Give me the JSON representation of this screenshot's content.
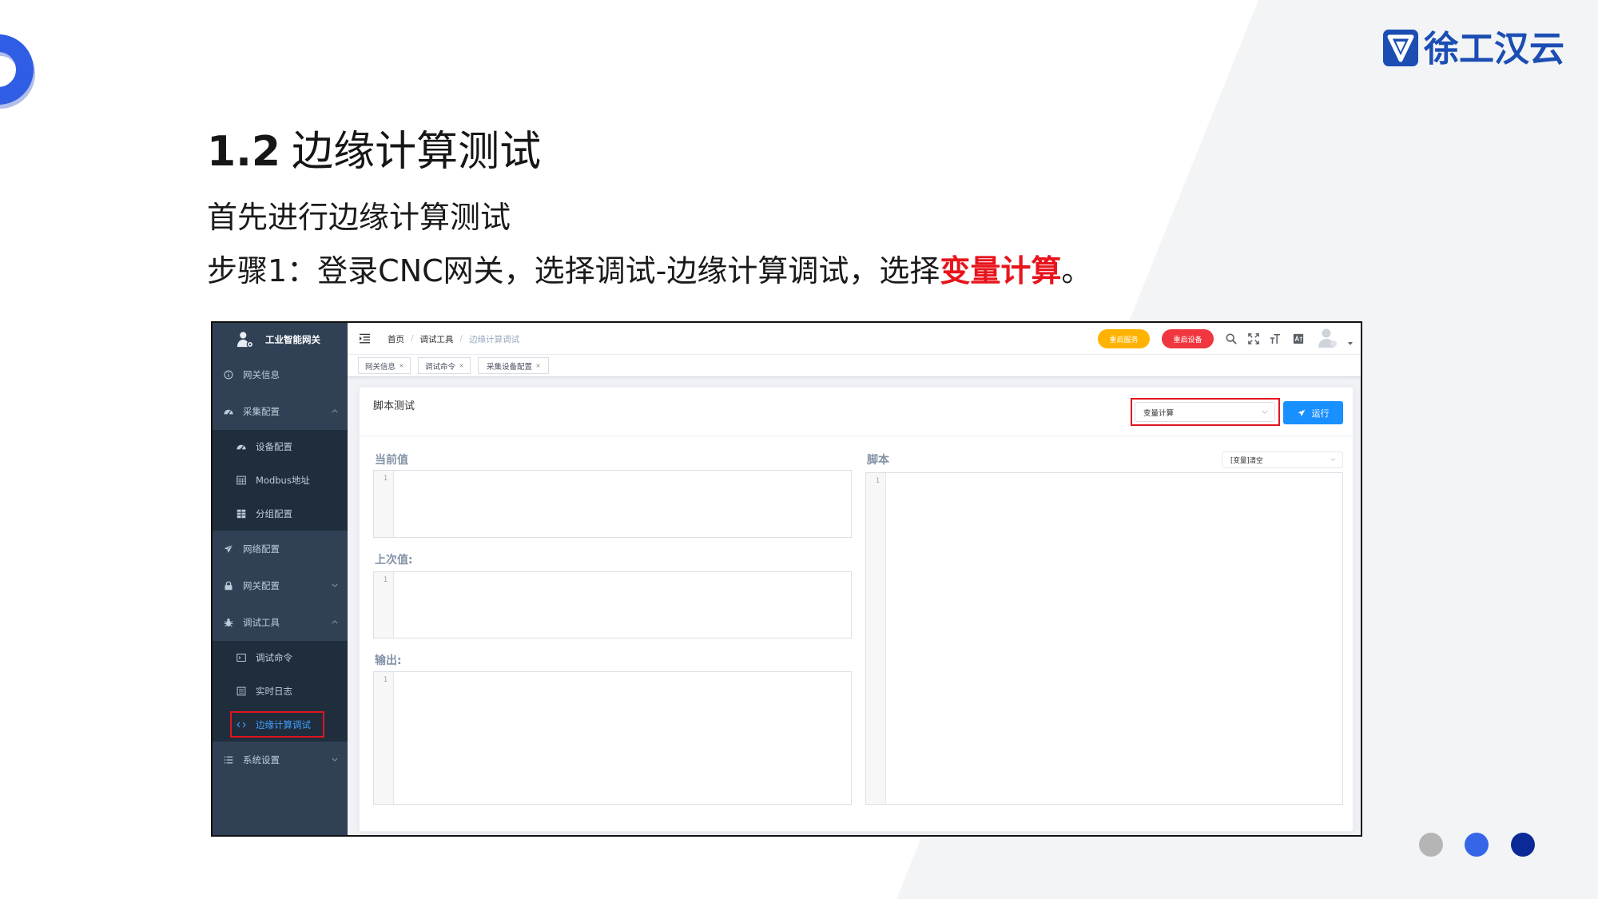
{
  "theme": {
    "brand_blue": "#1b4db3",
    "highlight_red": "#e8141c",
    "sidebar_bg": "#304156",
    "submenu_bg": "#1f2d3d",
    "sidebar_text": "#bfcbd9",
    "active_blue": "#409eff",
    "run_button": "#1890ff",
    "restart_service": "#ffb300",
    "restart_device": "#f0363f",
    "annotation_red": "#e0141e",
    "dot_gray": "#b5b5b5",
    "dot_blue": "#3566e8",
    "dot_navy": "#0b2a98"
  },
  "slide": {
    "logo_text": "徐工汉云",
    "logo_icon": "shield-logo-icon",
    "title_number": "1.2",
    "title_text": "边缘计算测试",
    "intro": "首先进行边缘计算测试",
    "step_prefix": "步骤1：登录CNC网关，选择调试-边缘计算调试，选择",
    "step_highlight": "变量计算",
    "step_suffix": "。"
  },
  "app": {
    "sidebar": {
      "title": "工业智能网关",
      "items": [
        {
          "label": "网关信息",
          "icon": "info-icon"
        },
        {
          "label": "采集配置",
          "icon": "dashboard-icon",
          "expanded": true,
          "children": [
            {
              "label": "设备配置",
              "icon": "dashboard-icon"
            },
            {
              "label": "Modbus地址",
              "icon": "table-icon"
            },
            {
              "label": "分组配置",
              "icon": "grid-icon"
            }
          ]
        },
        {
          "label": "网络配置",
          "icon": "send-icon"
        },
        {
          "label": "网关配置",
          "icon": "lock-icon",
          "expanded": false
        },
        {
          "label": "调试工具",
          "icon": "bug-icon",
          "expanded": true,
          "children": [
            {
              "label": "调试命令",
              "icon": "terminal-icon"
            },
            {
              "label": "实时日志",
              "icon": "log-icon"
            },
            {
              "label": "边缘计算调试",
              "icon": "code-icon",
              "active": true
            }
          ]
        },
        {
          "label": "系统设置",
          "icon": "list-icon",
          "expanded": false
        }
      ]
    },
    "navbar": {
      "breadcrumb": [
        "首页",
        "调试工具",
        "边缘计算调试"
      ],
      "separator": "/",
      "restart_service": "重启服务",
      "restart_device": "重启设备"
    },
    "tags": [
      "网关信息",
      "调试命令",
      "采集设备配置"
    ],
    "card": {
      "title": "脚本测试",
      "mode_select": "变量计算",
      "run_label": "运行",
      "current_label": "当前值",
      "previous_label": "上次值:",
      "output_label": "输出:",
      "script_label": "脚本",
      "script_select": "[变量]清空",
      "line_number": "1"
    }
  }
}
